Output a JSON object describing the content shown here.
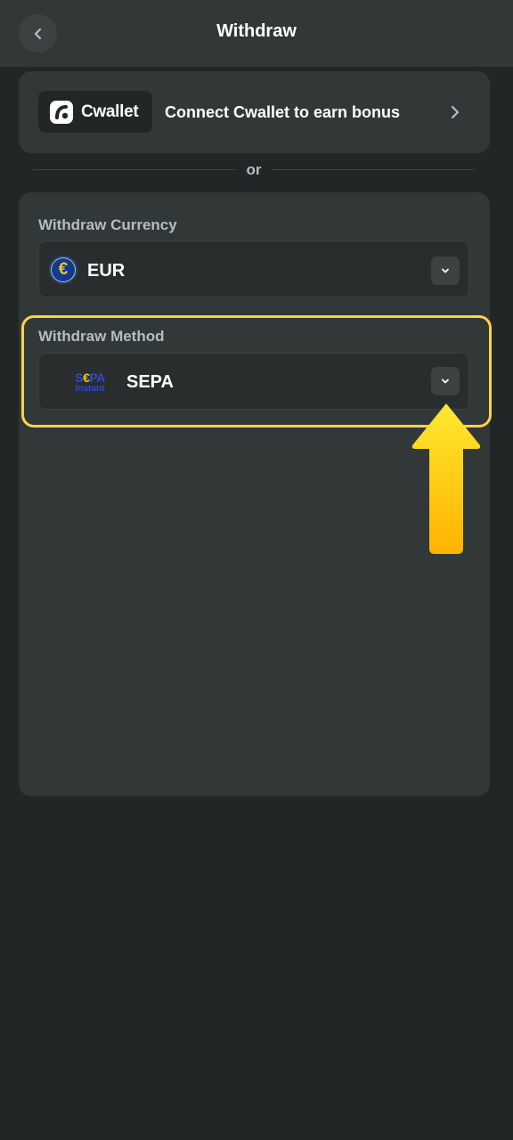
{
  "header": {
    "title": "Withdraw",
    "back_icon": "chevron-left-icon"
  },
  "cwallet": {
    "logo_text": "Cwallet",
    "promo_text": "Connect Cwallet to earn bonus",
    "chevron_icon": "chevron-right-icon"
  },
  "divider": {
    "text": "or"
  },
  "currency": {
    "label": "Withdraw Currency",
    "value": "EUR",
    "icon": "euro-icon",
    "icon_glyph": "€",
    "dropdown_icon": "chevron-down-icon"
  },
  "method": {
    "label": "Withdraw Method",
    "value": "SEPA",
    "logo_line1_a": "S",
    "logo_line1_b": "€",
    "logo_line1_c": "PA",
    "logo_line2": "Instant",
    "dropdown_icon": "chevron-down-icon"
  },
  "colors": {
    "background": "#232626",
    "surface": "#323738",
    "highlight": "#ffd24a",
    "arrow": "#ffc107"
  }
}
